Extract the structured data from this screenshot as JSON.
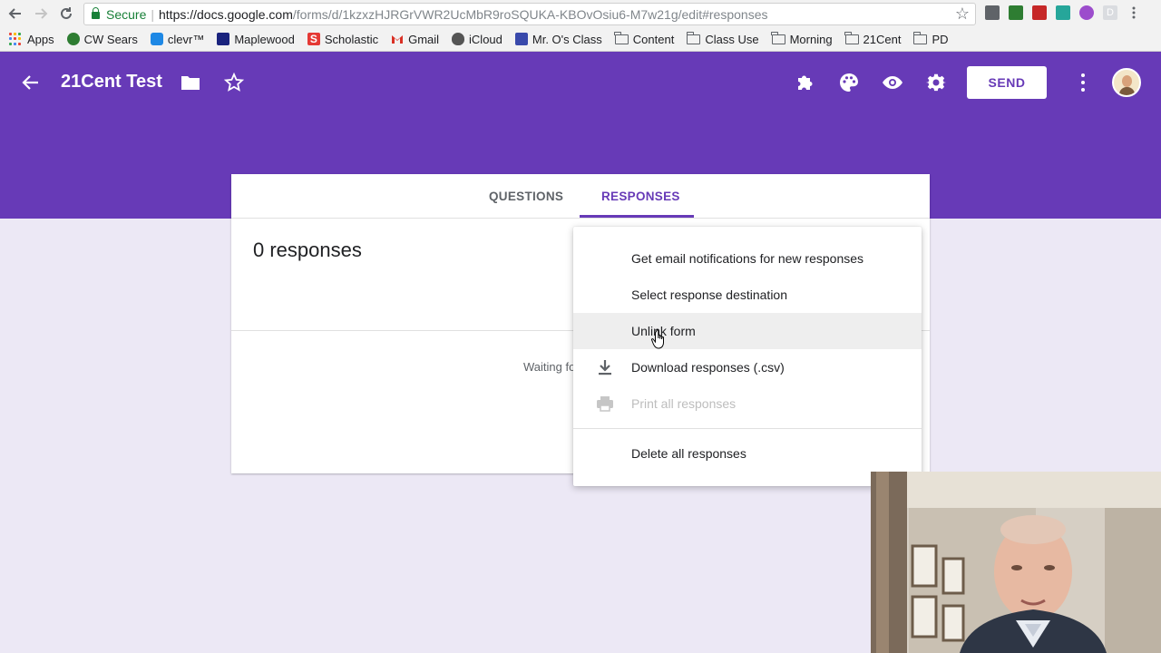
{
  "browser": {
    "secure_label": "Secure",
    "url_host": "https://docs.google.com",
    "url_path": "/forms/d/1kzxzHJRGrVWR2UcMbR9roSQUKA-KBOvOsiu6-M7w21g/edit#responses",
    "bookmarks": [
      {
        "label": "Apps",
        "icon": "apps-grid-icon"
      },
      {
        "label": "CW Sears",
        "icon": "cw-sears-icon",
        "color": "#2e7d32"
      },
      {
        "label": "clevr™",
        "icon": "clever-icon",
        "color": "#1e88e5"
      },
      {
        "label": "Maplewood",
        "icon": "maplewood-icon",
        "color": "#1a237e"
      },
      {
        "label": "Scholastic",
        "icon": "scholastic-icon",
        "color": "#e53935"
      },
      {
        "label": "Gmail",
        "icon": "gmail-icon",
        "color": "#d93025"
      },
      {
        "label": "iCloud",
        "icon": "apple-icon",
        "color": "#555555"
      },
      {
        "label": "Mr. O's Class",
        "icon": "classroom-site-icon",
        "color": "#3949ab"
      },
      {
        "label": "Content",
        "icon": "folder-icon"
      },
      {
        "label": "Class Use",
        "icon": "folder-icon"
      },
      {
        "label": "Morning",
        "icon": "folder-icon"
      },
      {
        "label": "21Cent",
        "icon": "folder-icon"
      },
      {
        "label": "PD",
        "icon": "folder-icon"
      }
    ]
  },
  "header": {
    "form_title": "21Cent Test",
    "send_label": "SEND",
    "accent": "#673ab7"
  },
  "tabs": {
    "questions": "QUESTIONS",
    "responses": "RESPONSES"
  },
  "responses": {
    "count_label": "0 responses",
    "waiting_text": "Waiting fo"
  },
  "menu": {
    "items": [
      {
        "label": "Get email notifications for new responses",
        "enabled": true
      },
      {
        "label": "Select response destination",
        "enabled": true
      },
      {
        "label": "Unlink form",
        "enabled": true,
        "hovered": true
      },
      {
        "label": "Download responses (.csv)",
        "enabled": true,
        "icon": "download-icon"
      },
      {
        "label": "Print all responses",
        "enabled": false,
        "icon": "print-icon"
      },
      {
        "label": "Delete all responses",
        "enabled": true
      }
    ]
  }
}
